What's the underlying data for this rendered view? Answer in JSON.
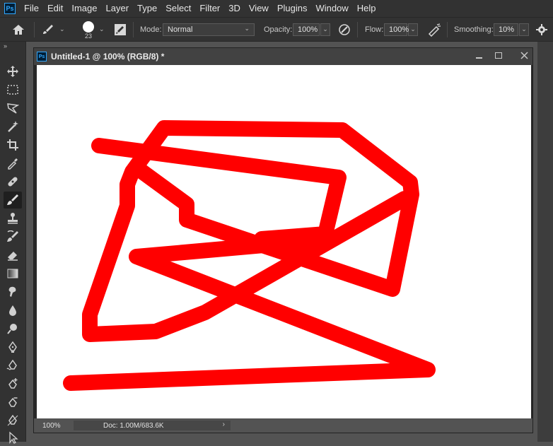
{
  "app": {
    "logo": "Ps"
  },
  "menu": [
    "File",
    "Edit",
    "Image",
    "Layer",
    "Type",
    "Select",
    "Filter",
    "3D",
    "View",
    "Plugins",
    "Window",
    "Help"
  ],
  "options": {
    "brush_size": "23",
    "mode_label": "Mode:",
    "mode_value": "Normal",
    "opacity_label": "Opacity:",
    "opacity_value": "100%",
    "flow_label": "Flow:",
    "flow_value": "100%",
    "smoothing_label": "Smoothing:",
    "smoothing_value": "10%"
  },
  "toolbar": {
    "collapse": "»",
    "tools": [
      "move",
      "marquee",
      "lasso",
      "magic-wand",
      "crop",
      "eyedropper",
      "healing",
      "brush",
      "stamp",
      "history-brush",
      "eraser",
      "gradient",
      "smudge",
      "blur",
      "dodge",
      "pen",
      "freeform-pen",
      "add-anchor",
      "delete-anchor",
      "convert-point",
      "path-select"
    ],
    "active": "brush"
  },
  "document": {
    "title": "Untitled-1 @ 100% (RGB/8) *",
    "zoom": "100%",
    "doc_info": "Doc: 1.00M/683.6K",
    "stroke_color": "#ff0000",
    "canvas_color": "#ffffff"
  }
}
